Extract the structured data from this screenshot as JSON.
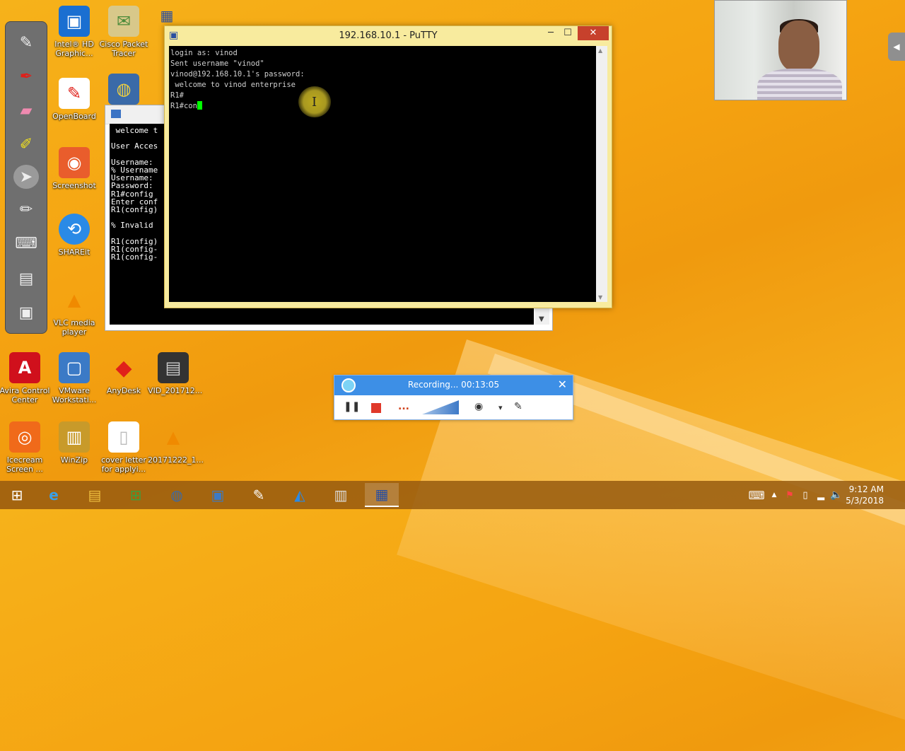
{
  "desktop": {
    "icons": [
      {
        "label": "Intel® HD Graphic...",
        "glyph": "▣",
        "color": "#1a6fd1"
      },
      {
        "label": "Cisco Packet Tracer",
        "glyph": "✉",
        "color": "#4a8a3a"
      },
      {
        "label": "OpenBoard",
        "glyph": "✎",
        "color": "#ffffff"
      },
      {
        "label": "Screenshot",
        "glyph": "◉",
        "color": "#e95d2c"
      },
      {
        "label": "SHAREit",
        "glyph": "⟲",
        "color": "#2a8ae6"
      },
      {
        "label": "VLC media player",
        "glyph": "▲",
        "color": "#f08a00"
      },
      {
        "label": "Avira Control Center",
        "glyph": "A",
        "color": "#d0101c"
      },
      {
        "label": "VMware Workstati...",
        "glyph": "▢",
        "color": "#3b7ac6"
      },
      {
        "label": "AnyDesk",
        "glyph": "◆",
        "color": "#e0201a"
      },
      {
        "label": "VID_201712...",
        "glyph": "▤",
        "color": "#333333"
      },
      {
        "label": "Icecream Screen ...",
        "glyph": "◎",
        "color": "#f06a1a"
      },
      {
        "label": "WinZip",
        "glyph": "▥",
        "color": "#c89a2a"
      },
      {
        "label": "cover letter for applyi...",
        "glyph": "▯",
        "color": "#ffffff"
      },
      {
        "label": "20171222_1...",
        "glyph": "▲",
        "color": "#f08a00"
      }
    ]
  },
  "putty": {
    "title": "192.168.10.1 - PuTTY",
    "minimize": "─",
    "maximize": "☐",
    "close": "✕",
    "lines": [
      "login as: vinod",
      "Sent username \"vinod\"",
      "vinod@192.168.10.1's password:",
      " welcome to vinod enterprise",
      "R1#"
    ],
    "current_line": "R1#con"
  },
  "cmd_back": {
    "lines": [
      " welcome t",
      "",
      "User Acces",
      "",
      "Username:",
      "% Username",
      "Username:",
      "Password:",
      "R1#config",
      "Enter conf",
      "R1(config)",
      "",
      "% Invalid",
      "",
      "R1(config)",
      "R1(config-",
      "R1(config-"
    ]
  },
  "recorder": {
    "status": "Recording... 00:13:05",
    "close": "✕",
    "pause": "❚❚",
    "more": "...",
    "webcam_toggle": "◉",
    "dropdown": "▾",
    "pen": "✎"
  },
  "taskbar": {
    "start_icon": "windows-start-icon",
    "items": [
      "e",
      "▤",
      "⊞",
      "◍",
      "▣",
      "✎",
      "◭",
      "▥",
      "▦"
    ],
    "tray_up": "▲",
    "time": "9:12 AM",
    "date": "5/3/2018"
  },
  "colors": {
    "desktop": "#f5a311",
    "putty_frame": "#f8eb9e",
    "recorder_bar": "#3d8fe6",
    "close_red": "#c7412c",
    "terminal_cursor": "#00ff00"
  }
}
